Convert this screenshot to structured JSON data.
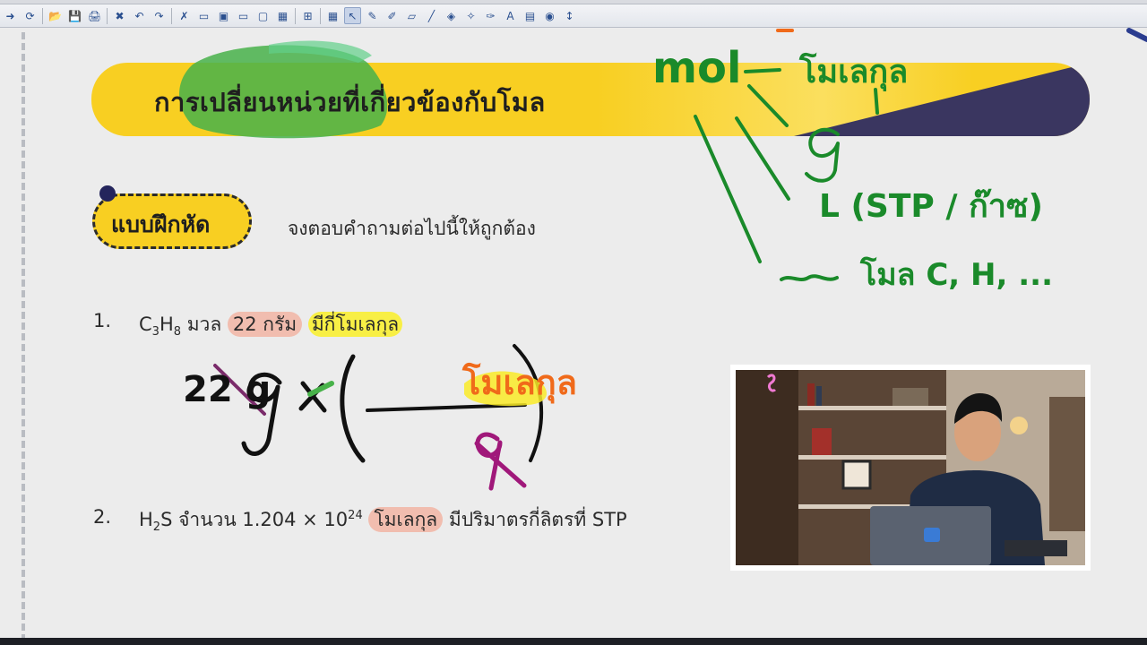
{
  "toolbar": {
    "buttons": [
      "new-icon",
      "open-icon",
      "save-icon",
      "print-icon",
      "close-doc-icon",
      "undo-icon",
      "redo-icon",
      "delete-icon",
      "monitor-icon",
      "present-icon",
      "screen-icon",
      "display-icon",
      "board-icon",
      "screen-capture-icon",
      "grid-icon",
      "pointer-icon",
      "pen-icon",
      "highlighter-icon",
      "eraser-icon",
      "line-icon",
      "fill-icon",
      "magic-pen-icon",
      "color-picker-icon",
      "text-icon",
      "image-icon",
      "zoom-icon",
      "move-icon",
      "settings-icon"
    ],
    "glyphs": [
      "➜",
      "⟳",
      "📂",
      "💾",
      "🖨",
      "✖",
      "↶",
      "↷",
      "✗",
      "▭",
      "▣",
      "▭",
      "▢",
      "▦",
      "⊞",
      "▦",
      "↖",
      "✎",
      "✐",
      "▱",
      "╱",
      "◈",
      "✧",
      "✑",
      "A",
      "▤",
      "◉",
      "↕"
    ],
    "active_tool": "pen-icon"
  },
  "slide": {
    "title": "การเปลี่ยนหน่วยที่เกี่ยวข้องกับโมล",
    "practice_label": "แบบฝึกหัด",
    "instruction": "จงตอบคำถามต่อไปนี้ให้ถูกต้อง",
    "q1": {
      "number": "1.",
      "formula_c": "C",
      "sub1": "3",
      "formula_h": "H",
      "sub2": "8",
      "mid": " มวล ",
      "mass": "22 กรัม",
      "ask": "มีกี่โมเลกุล"
    },
    "q2": {
      "number": "2.",
      "formula_h": "H",
      "sub": "2",
      "formula_s": "S",
      "mid": " จำนวน 1.204 × 10",
      "exp": "24",
      "unit": "โมเลกุล",
      "ask": " มีปริมาตรกี่ลิตรที่ STP"
    }
  },
  "colors": {
    "banner": "#f8cf22",
    "banner_dark": "#3a3660",
    "ink_green": "#1a8a2a",
    "ink_black": "#111111",
    "ink_orange": "#f06a1a",
    "ink_magenta": "#a0187a"
  },
  "handwriting": {
    "mol": "mol",
    "molecule": "โมเลกุล",
    "gram": "g",
    "litre": "L (STP / ก๊าซ)",
    "atoms": "โมล C, H, ...",
    "calc_22g": "22 g",
    "calc_x": "×",
    "calc_molecule": "โมเลกุล",
    "calc_g": "g"
  }
}
